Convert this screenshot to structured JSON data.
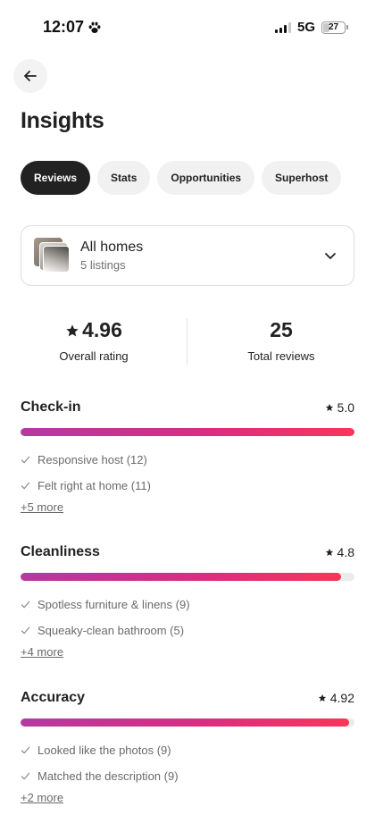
{
  "status_bar": {
    "time": "12:07",
    "network": "5G",
    "battery": "27",
    "battery_level": 0.27
  },
  "header": {
    "title": "Insights"
  },
  "tabs": [
    {
      "label": "Reviews",
      "active": true
    },
    {
      "label": "Stats",
      "active": false
    },
    {
      "label": "Opportunities",
      "active": false
    },
    {
      "label": "Superhost",
      "active": false
    }
  ],
  "listing_selector": {
    "title": "All homes",
    "subtitle": "5 listings"
  },
  "summary": {
    "rating_value": "4.96",
    "rating_label": "Overall rating",
    "reviews_value": "25",
    "reviews_label": "Total reviews"
  },
  "categories": [
    {
      "name": "Check-in",
      "score": "5.0",
      "score_fraction": 1.0,
      "items": [
        "Responsive host (12)",
        "Felt right at home (11)"
      ],
      "more": "+5 more"
    },
    {
      "name": "Cleanliness",
      "score": "4.8",
      "score_fraction": 0.96,
      "items": [
        "Spotless furniture & linens (9)",
        "Squeaky-clean bathroom (5)"
      ],
      "more": "+4 more"
    },
    {
      "name": "Accuracy",
      "score": "4.92",
      "score_fraction": 0.984,
      "items": [
        "Looked like the photos (9)",
        "Matched the description (9)"
      ],
      "more": "+2 more"
    }
  ],
  "colors": {
    "bar_start": "#b43aa0",
    "bar_end": "#f8365a",
    "active_tab": "#222222"
  },
  "icons": [
    "paw-icon",
    "signal-icon",
    "battery-icon",
    "back-arrow-icon",
    "chevron-down-icon",
    "star-icon",
    "check-icon"
  ]
}
